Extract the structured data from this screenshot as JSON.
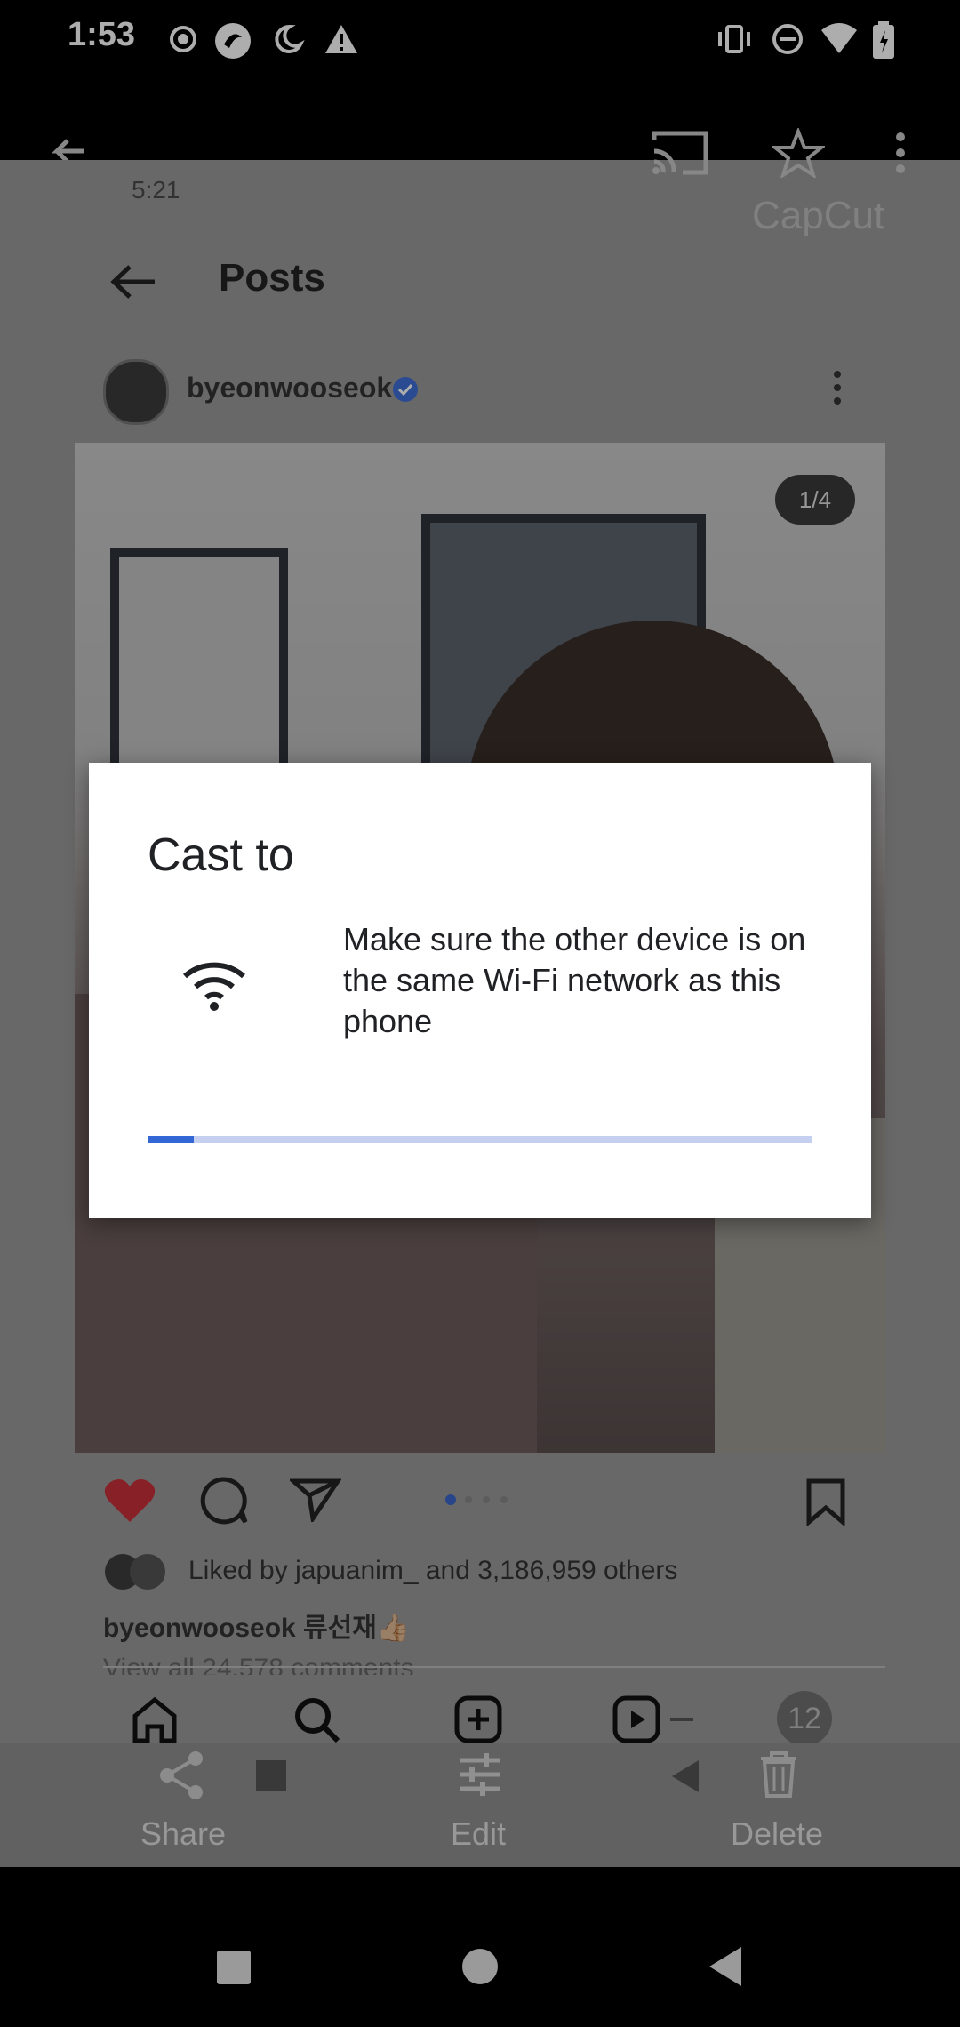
{
  "status_bar": {
    "time": "1:53",
    "left_icons": [
      "record-icon",
      "vpn-icon",
      "do-not-disturb-night-icon",
      "alert-icon"
    ],
    "right_icons": [
      "vibrate-icon",
      "dnd-icon",
      "wifi-icon",
      "battery-icon"
    ]
  },
  "app_bar": {
    "icons": [
      "back-arrow-icon",
      "cast-icon",
      "star-icon",
      "more-vert-icon"
    ]
  },
  "inner_screenshot": {
    "status_time": "5:21",
    "watermark": "CapCut",
    "header_title": "Posts",
    "username": "byeonwooseok",
    "photo_counter": "1/4",
    "liked_by": "Liked by japuanim_ and 3,186,959 others",
    "caption": "byeonwooseok 류선재👍🏼",
    "view_comments": "View all 24,578 comments",
    "badge_count": "12"
  },
  "cast_dialog": {
    "title": "Cast to",
    "message": "Make sure the other device is on the same Wi-Fi network as this phone",
    "progress": 0.07
  },
  "action_bar": {
    "share_label": "Share",
    "edit_label": "Edit",
    "delete_label": "Delete"
  },
  "colors": {
    "accent": "#3367d6",
    "progress_track": "#c5cff0",
    "heart": "#e0242f"
  }
}
